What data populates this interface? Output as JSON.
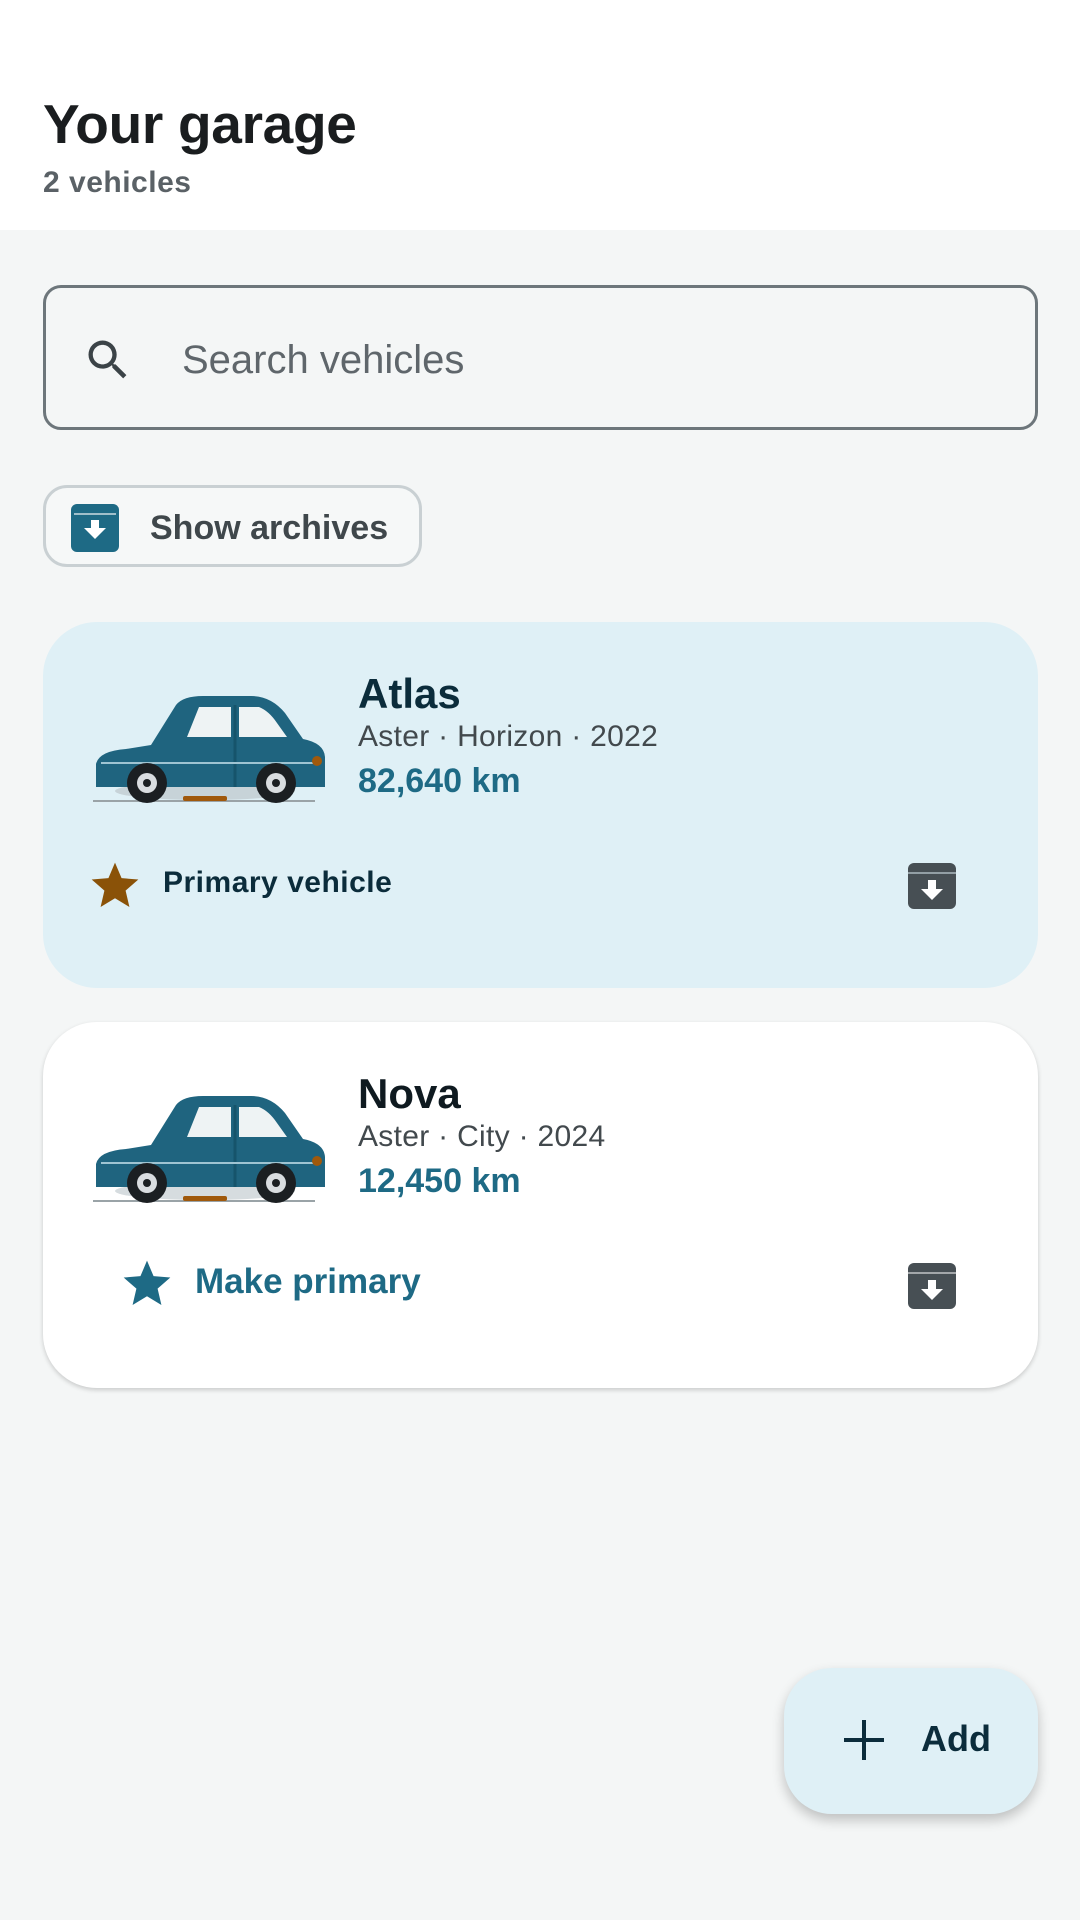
{
  "header": {
    "title": "Your garage",
    "subtitle": "2 vehicles"
  },
  "search": {
    "placeholder": "Search vehicles",
    "icon": "search-icon"
  },
  "archives_chip": {
    "label": "Show archives",
    "icon": "archive-icon"
  },
  "vehicles": [
    {
      "name": "Atlas",
      "details": "Aster · Horizon · 2022",
      "mileage": "82,640 km",
      "status_label": "Primary vehicle",
      "is_primary": true
    },
    {
      "name": "Nova",
      "details": "Aster · City · 2024",
      "mileage": "12,450 km",
      "action_label": "Make primary",
      "is_primary": false
    }
  ],
  "fab": {
    "label": "Add",
    "icon": "plus-icon"
  },
  "colors": {
    "accent": "#1e6a85",
    "primary_card_bg": "#dff0f6",
    "primary_star": "#8a5208",
    "car_body": "#1f647f"
  }
}
